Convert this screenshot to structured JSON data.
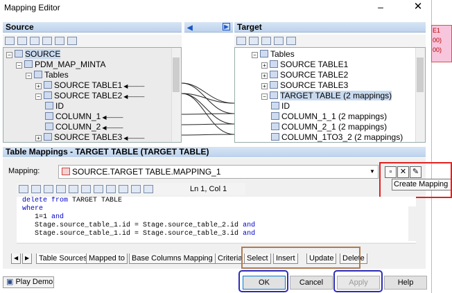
{
  "window": {
    "title": "Mapping Editor",
    "minimize": "–",
    "close": "✕"
  },
  "side_strip": [
    "E1",
    "00)",
    "00)"
  ],
  "source": {
    "header": "Source",
    "tree": [
      {
        "label": "SOURCE",
        "indent": 0,
        "exp": "−",
        "sel": true
      },
      {
        "label": "PDM_MAP_MINTA",
        "indent": 1,
        "exp": "−"
      },
      {
        "label": "Tables",
        "indent": 2,
        "exp": "−"
      },
      {
        "label": "SOURCE TABLE1",
        "indent": 3,
        "exp": "+",
        "arrow": true
      },
      {
        "label": "SOURCE TABLE2",
        "indent": 3,
        "exp": "−",
        "arrow": true
      },
      {
        "label": "ID",
        "indent": 4
      },
      {
        "label": "COLUMN_1",
        "indent": 4,
        "arrow": true
      },
      {
        "label": "COLUMN_2",
        "indent": 4,
        "arrow": true
      },
      {
        "label": "SOURCE TABLE3",
        "indent": 3,
        "exp": "+",
        "arrow": true
      }
    ]
  },
  "target": {
    "header": "Target",
    "tree": [
      {
        "label": "Tables",
        "indent": 0,
        "exp": "−"
      },
      {
        "label": "SOURCE TABLE1",
        "indent": 1,
        "exp": "+"
      },
      {
        "label": "SOURCE TABLE2",
        "indent": 1,
        "exp": "+"
      },
      {
        "label": "SOURCE TABLE3",
        "indent": 1,
        "exp": "+"
      },
      {
        "label": "TARGET TABLE (2 mappings)",
        "indent": 1,
        "exp": "−",
        "sel": true
      },
      {
        "label": "ID",
        "indent": 2
      },
      {
        "label": "COLUMN_1_1 (2 mappings)",
        "indent": 2
      },
      {
        "label": "COLUMN_2_1 (2 mappings)",
        "indent": 2
      },
      {
        "label": "COLUMN_1TO3_2 (2 mappings)",
        "indent": 2
      }
    ]
  },
  "mappings_section": {
    "header": "Table Mappings - TARGET TABLE (TARGET TABLE)",
    "mapping_label": "Mapping:",
    "mapping_value": "SOURCE.TARGET TABLE.MAPPING_1",
    "create_tooltip": "Create Mapping",
    "cursor_pos": "Ln 1, Col 1"
  },
  "code": [
    [
      {
        "t": "delete from",
        "k": true
      },
      {
        "t": " TARGET TABLE"
      }
    ],
    [
      {
        "t": "where",
        "k": true
      }
    ],
    [
      {
        "t": "   1=1 "
      },
      {
        "t": "and",
        "k": true
      }
    ],
    [
      {
        "t": "   Stage.source_table_1.id = Stage.source_table_2.id "
      },
      {
        "t": "and",
        "k": true
      }
    ],
    [
      {
        "t": "   Stage.source_table_1.id = Stage.source_table_3.id "
      },
      {
        "t": "and",
        "k": true
      }
    ]
  ],
  "tabs": [
    "Table Sources",
    "Mapped to",
    "Base Columns Mapping",
    "Criteria",
    "Select",
    "Insert",
    "Update",
    "Delete"
  ],
  "buttons": {
    "play_demo": "Play Demo",
    "ok": "OK",
    "cancel": "Cancel",
    "apply": "Apply",
    "help": "Help"
  },
  "colors": {
    "red_box": "#e02020",
    "brown_box": "#b07a50",
    "blue_box": "#2c2cb8",
    "header_blue": "#bcd2ec"
  }
}
